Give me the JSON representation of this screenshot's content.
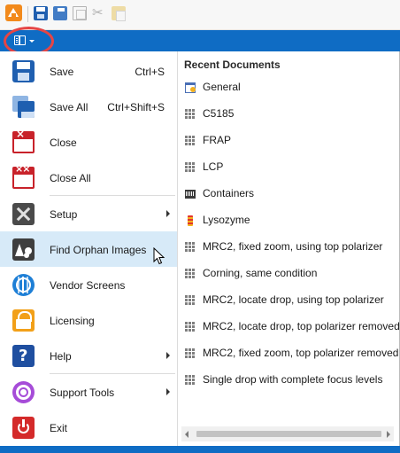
{
  "ribbon": {
    "color": "#0f6cc4"
  },
  "quick_access": {
    "icons": [
      "app-logo-icon",
      "save-icon",
      "save-all-icon",
      "copy-icon",
      "cut-icon",
      "paste-icon"
    ]
  },
  "menu": {
    "items": [
      {
        "label": "Save",
        "shortcut": "Ctrl+S",
        "icon": "save-icon"
      },
      {
        "label": "Save All",
        "shortcut": "Ctrl+Shift+S",
        "icon": "save-all-icon"
      },
      {
        "label": "Close",
        "icon": "close-document-icon"
      },
      {
        "label": "Close All",
        "icon": "close-all-icon"
      },
      {
        "label": "Setup",
        "icon": "tools-icon",
        "submenu": true
      },
      {
        "label": "Find Orphan Images",
        "icon": "orphan-images-icon",
        "hovered": true
      },
      {
        "label": "Vendor Screens",
        "icon": "globe-icon"
      },
      {
        "label": "Licensing",
        "icon": "lock-icon"
      },
      {
        "label": "Help",
        "icon": "help-icon",
        "submenu": true
      },
      {
        "label": "Support Tools",
        "icon": "lifebuoy-icon",
        "submenu": true
      },
      {
        "label": "Exit",
        "icon": "power-icon"
      }
    ],
    "hover_color": "#d7eaf8"
  },
  "recent": {
    "title": "Recent Documents",
    "items": [
      {
        "label": "General",
        "icon": "calendar-icon"
      },
      {
        "label": "C5185",
        "icon": "plate-grid-icon"
      },
      {
        "label": "FRAP",
        "icon": "plate-grid-icon"
      },
      {
        "label": "LCP",
        "icon": "plate-grid-icon"
      },
      {
        "label": "Containers",
        "icon": "containers-icon"
      },
      {
        "label": "Lysozyme",
        "icon": "sample-tube-icon"
      },
      {
        "label": "MRC2, fixed zoom, using top polarizer",
        "icon": "plate-grid-icon"
      },
      {
        "label": "Corning, same condition",
        "icon": "plate-grid-icon"
      },
      {
        "label": "MRC2, locate drop, using top polarizer",
        "icon": "plate-grid-icon"
      },
      {
        "label": "MRC2, locate drop, top polarizer removed",
        "icon": "plate-grid-icon"
      },
      {
        "label": "MRC2, fixed zoom, top polarizer removed",
        "icon": "plate-grid-icon"
      },
      {
        "label": "Single drop with complete focus levels",
        "icon": "plate-grid-icon"
      }
    ]
  }
}
